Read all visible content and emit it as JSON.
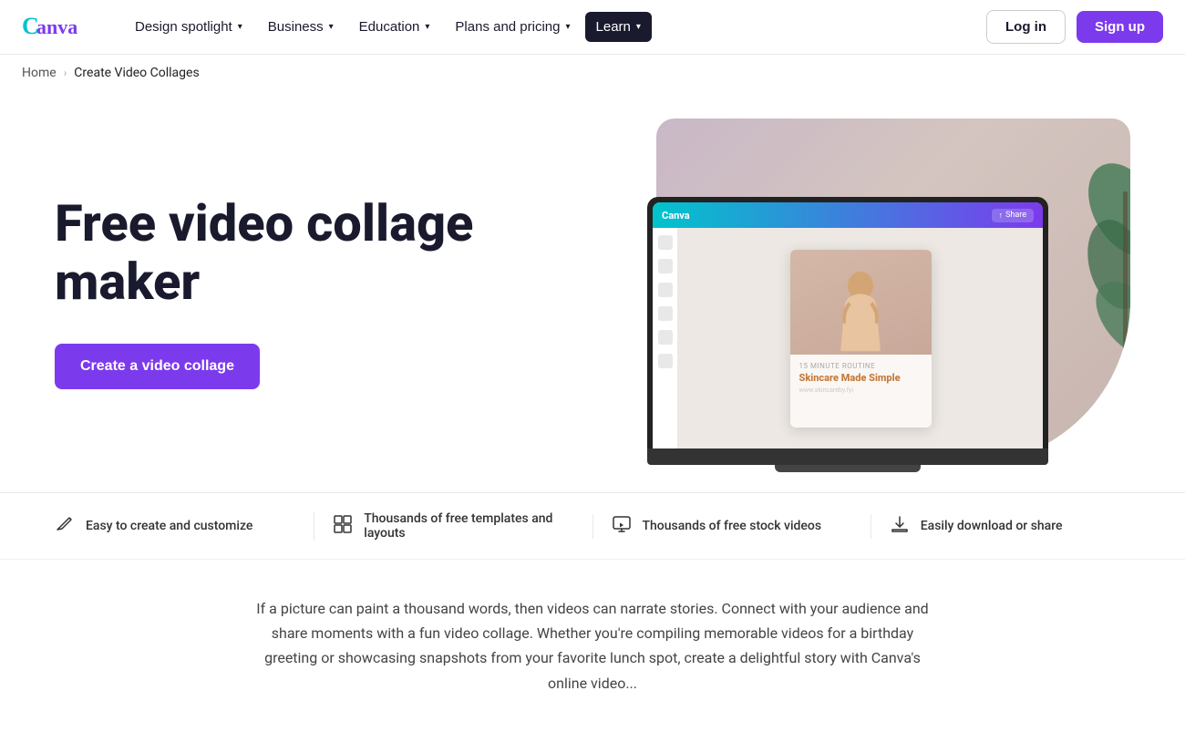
{
  "brand": {
    "name": "Canva",
    "logo_text": "Canva"
  },
  "nav": {
    "links": [
      {
        "id": "design-spotlight",
        "label": "Design spotlight",
        "has_dropdown": true
      },
      {
        "id": "business",
        "label": "Business",
        "has_dropdown": true
      },
      {
        "id": "education",
        "label": "Education",
        "has_dropdown": true
      },
      {
        "id": "plans-pricing",
        "label": "Plans and pricing",
        "has_dropdown": true
      },
      {
        "id": "learn",
        "label": "Learn",
        "has_dropdown": true,
        "active": true
      }
    ],
    "login_label": "Log in",
    "signup_label": "Sign up"
  },
  "breadcrumb": {
    "home": "Home",
    "current": "Create Video Collages"
  },
  "hero": {
    "title": "Free video collage maker",
    "cta_label": "Create a video collage",
    "screen_title": "Skincare Made Simple",
    "screen_subtitle": "www.skincareby.fyi"
  },
  "features": [
    {
      "id": "easy-create",
      "icon": "✏️",
      "text": "Easy to create and customize"
    },
    {
      "id": "templates",
      "icon": "⊞",
      "text": "Thousands of free templates and layouts"
    },
    {
      "id": "stock-videos",
      "icon": "🖥",
      "text": "Thousands of free stock videos"
    },
    {
      "id": "download-share",
      "icon": "⬇",
      "text": "Easily download or share"
    }
  ],
  "description": {
    "text": "If a picture can paint a thousand words, then videos can narrate stories. Connect with your audience and share moments with a fun video collage. Whether you're compiling memorable videos for a birthday greeting or showcasing snapshots from your favorite lunch spot, create a delightful story with Canva's online video..."
  }
}
